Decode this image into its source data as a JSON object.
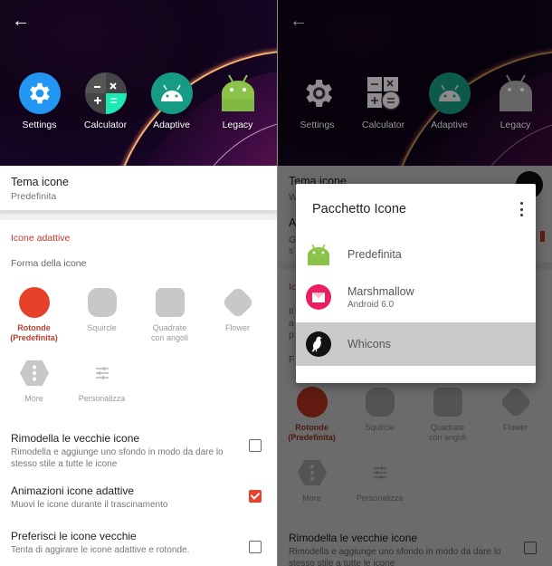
{
  "left": {
    "header": {
      "back_icon": "arrow-left-icon"
    },
    "apps": [
      {
        "label": "Settings",
        "icon": "settings-icon"
      },
      {
        "label": "Calculator",
        "icon": "calculator-icon"
      },
      {
        "label": "Adaptive",
        "icon": "android-adaptive-icon"
      },
      {
        "label": "Legacy",
        "icon": "android-legacy-icon"
      }
    ],
    "theme": {
      "title": "Tema icone",
      "value": "Predefinita"
    },
    "section_title": "Icone adattive",
    "shape_label": "Forma della icone",
    "shapes": [
      {
        "label": "Rotonde\n(Predefinita)",
        "line1": "Rotonde",
        "line2": "(Predefinita)",
        "selected": true
      },
      {
        "label": "Squircle",
        "line1": "Squircle",
        "line2": "",
        "selected": false
      },
      {
        "label": "Quadrate con angoli",
        "line1": "Quadrate",
        "line2": "con angoli",
        "selected": false
      },
      {
        "label": "Flower",
        "line1": "Flower",
        "line2": "",
        "selected": false
      },
      {
        "label": "More",
        "line1": "More",
        "line2": "",
        "selected": false
      },
      {
        "label": "Personalizza",
        "line1": "Personalizza",
        "line2": "",
        "selected": false
      }
    ],
    "options": [
      {
        "title": "Rimodella le vecchie icone",
        "sub": "Rimodella e aggiunge uno sfondo in modo da dare lo stesso stile a tutte le icone",
        "checked": false
      },
      {
        "title": "Animazioni icone adattive",
        "sub": "Muovi le icone durante il trascinamento",
        "checked": true
      },
      {
        "title": "Preferisci le icone vecchie",
        "sub": "Tenta di aggirare le icone adattive e rotonde.",
        "checked": false
      }
    ]
  },
  "right": {
    "apps": [
      {
        "label": "Settings"
      },
      {
        "label": "Calculator"
      },
      {
        "label": "Adaptive"
      },
      {
        "label": "Legacy"
      }
    ],
    "background": {
      "theme_title": "Tema icone",
      "theme_value_peek": "W",
      "row2_title_peek": "A",
      "row2_sub_peek1": "G",
      "row2_sub_peek2": "s",
      "section_peek": "Ic",
      "para_peek1": "Il",
      "para_peek2": "a",
      "para_peek3": "p",
      "shape_label_peek": "F",
      "shapes": [
        {
          "line1": "Rotonde",
          "line2": "(Predefinita)"
        },
        {
          "line1": "Squircle",
          "line2": ""
        },
        {
          "line1": "Quadrate",
          "line2": "con angoli"
        },
        {
          "line1": "Flower",
          "line2": ""
        },
        {
          "line1": "More",
          "line2": ""
        },
        {
          "line1": "Personalizza",
          "line2": ""
        }
      ],
      "option": {
        "title": "Rimodella le vecchie icone",
        "sub": "Rimodella e aggiunge uno sfondo in modo da dare lo stesso stile a tutte le icone"
      }
    },
    "dialog": {
      "title": "Pacchetto Icone",
      "menu_icon": "more-vert-icon",
      "packs": [
        {
          "name": "Predefinita",
          "sub": "",
          "icon": "android-icon",
          "selected": false
        },
        {
          "name": "Marshmallow",
          "sub": "Android 6.0",
          "icon": "marshmallow-icon",
          "selected": false
        },
        {
          "name": "Whicons",
          "sub": "",
          "icon": "whicons-bird-icon",
          "selected": true
        }
      ]
    }
  },
  "colors": {
    "accent": "#e8412a",
    "section_header": "#c0392b",
    "selected_shape_label": "#b8412b",
    "settings_blue": "#2196f3",
    "adaptive_teal": "#169b85",
    "android_green": "#8bc34a",
    "marshmallow_pink": "#e91e63",
    "shape_gray": "#c8c8c8"
  }
}
